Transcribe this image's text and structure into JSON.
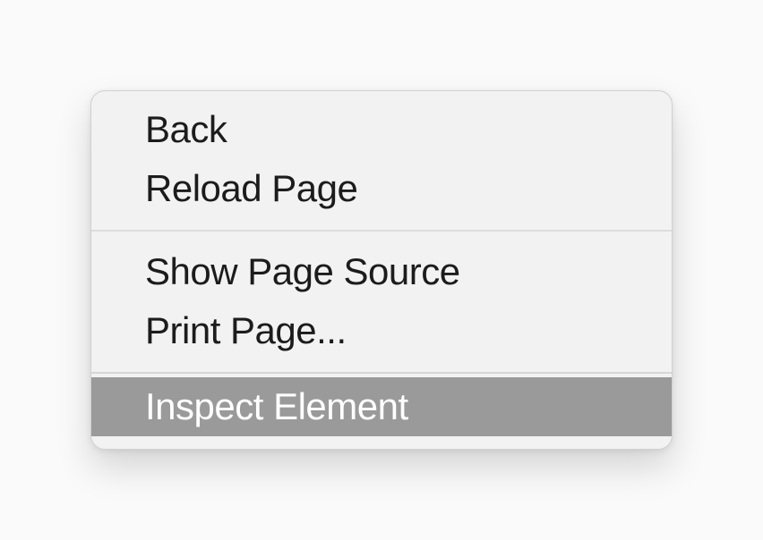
{
  "context_menu": {
    "items": [
      {
        "label": "Back",
        "hovered": false
      },
      {
        "label": "Reload Page",
        "hovered": false
      },
      {
        "label": "Show Page Source",
        "hovered": false
      },
      {
        "label": "Print Page...",
        "hovered": false
      },
      {
        "label": "Inspect Element",
        "hovered": true
      }
    ]
  }
}
